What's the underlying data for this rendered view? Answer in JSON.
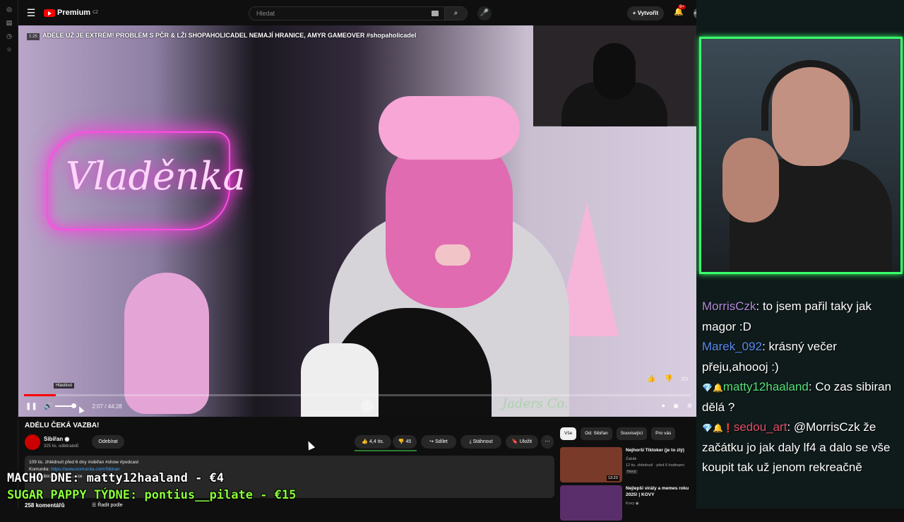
{
  "topbar": {
    "logo_text": "Premium",
    "logo_region": "CZ",
    "search_placeholder": "Hledat",
    "create_label": "+ Vytvořit",
    "notif_count": "9+",
    "avatar_text": "sibiran"
  },
  "player": {
    "overlay_title": "ADÉLE UŽ JE EXTRÉM! PROBLÉM S PČR & LŽI SHOPAHOLICADEL NEMAJÍ HRANICE, AMYR GAMEOVER #shopaholicadel",
    "time_chip": "1:25",
    "neon_text": "Vladěnka",
    "watermark": "Jaders Co.",
    "tooltip": "Hlasitost",
    "time": "2:07 / 44:28",
    "progress": 0.048,
    "volume": 0.8
  },
  "video": {
    "title": "ADÉLU ČEKÁ VAZBA!",
    "channel": "Sibiřan",
    "verified": "◉",
    "subs": "325 tis. odběratelů",
    "unsubscribe": "Odebírat",
    "likes": "4,4 tis.",
    "dislikes": "45",
    "share": "Sdílet",
    "download": "Stáhnout",
    "save": "Uložit",
    "more": "⋯",
    "desc_line1": "109 tis. zhlédnutí  před 6 dny  #sibiřan #show #podcast",
    "desc_line2_label": "Komunita: ",
    "desc_line2_link": "https://www.komunita.com/Sibiran",
    "desc_line3": "IG: @sibiran.official  ...více",
    "comments": "258 komentářů",
    "sort": "Řadit podle"
  },
  "related": {
    "chips": [
      "Vše",
      "Od: Sibiřan",
      "Související",
      "Pro vás"
    ],
    "items": [
      {
        "title": "Nejhorší Tiktoker (je to zlý)",
        "channel": "Žabák",
        "meta": "12 tis. zhlédnutí · před 6 hodinami",
        "badge": "Nový",
        "duration": "13:23"
      },
      {
        "title": "Nejlepší virály a memes roku 2025! | KOVY",
        "channel": "Kovy ◉",
        "meta": "",
        "badge": "",
        "duration": ""
      }
    ]
  },
  "stream": {
    "chat": [
      {
        "user": "MorrisCzk",
        "user_color": "#b08cd8",
        "icons": "",
        "text": ": to jsem pařil taky jak magor :D"
      },
      {
        "user": "Marek_092",
        "user_color": "#5a8cf0",
        "icons": "",
        "text": ": krásný večer přeju,ahoooj :)"
      },
      {
        "user": "matty12haaland",
        "user_color": "#53e07a",
        "icons": "💎🔔",
        "text": ": Co zas sibiran dělá ?"
      },
      {
        "user": "sedou_art",
        "user_color": "#e0506a",
        "icons": "💎🔔❗",
        "text": ": @MorrisCzk že začátku jo jak daly lf4 a dalo se vše koupit tak už jenom rekreačně"
      }
    ],
    "banner1": "MACHO DNE: matty12haaland - €4",
    "banner2": "SUGAR PAPPY TÝDNE: pontius__pilate - €15",
    "banner1_color": "#ffffff",
    "banner2_color": "#8cff3a",
    "cam_border": "#39ff6a"
  }
}
